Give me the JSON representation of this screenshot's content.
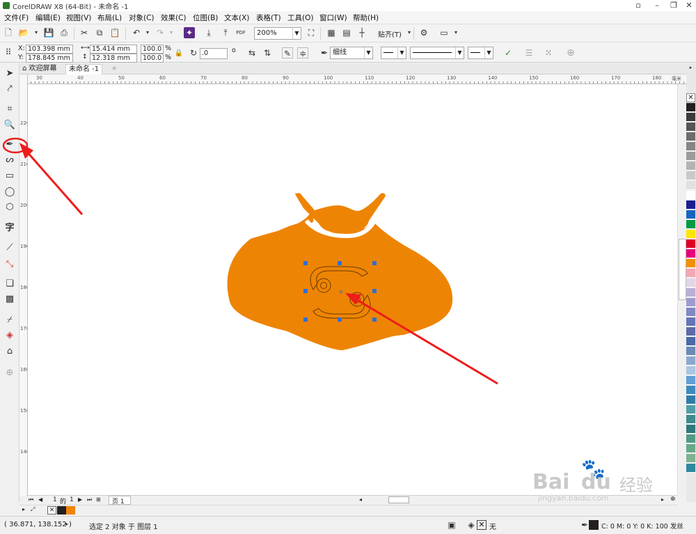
{
  "titlebar": {
    "title": "CorelDRAW X8 (64-Bit) - 未命名 -1",
    "restore": "▫",
    "minimize": "–",
    "maximize": "❐",
    "close": "✕"
  },
  "menu": [
    "文件(F)",
    "编辑(E)",
    "视图(V)",
    "布局(L)",
    "对象(C)",
    "效果(C)",
    "位图(B)",
    "文本(X)",
    "表格(T)",
    "工具(O)",
    "窗口(W)",
    "帮助(H)"
  ],
  "stdbar": {
    "zoom": "200%",
    "snap_label": "贴齐(T)",
    "pdf_label": "PDF"
  },
  "propbar": {
    "x_label": "X:",
    "x": "103.398 mm",
    "y_label": "Y:",
    "y": "178.845 mm",
    "w": "15.414 mm",
    "h": "12.318 mm",
    "sx": "100.0",
    "sy": "100.0",
    "pct": "%",
    "rotation": ".0",
    "deg": "o",
    "outline_width": "细线"
  },
  "tabs": {
    "welcome": "欢迎屏幕",
    "doc": "未命名 -1",
    "add": "+"
  },
  "ruler": {
    "h_ticks": [
      "30",
      "40",
      "50",
      "60",
      "70",
      "80",
      "90",
      "100",
      "110",
      "120",
      "130",
      "140",
      "150",
      "160",
      "170",
      "180"
    ],
    "h_unit": "毫米",
    "v_ticks": [
      "220",
      "210",
      "200",
      "190",
      "180",
      "170",
      "160",
      "150",
      "140"
    ]
  },
  "pagenav": {
    "current": "1",
    "of": "的",
    "total": "1",
    "page_tab": "页 1"
  },
  "status": {
    "coords": "( 36.871, 138.152 )",
    "selection": "选定 2 对象 于 图层 1",
    "fill_none": "无",
    "outline_info": "C: 0 M: 0 Y: 0 K: 100 发丝"
  },
  "colors": {
    "orange": "#ee8403",
    "handle": "#2f6fd1",
    "arrow": "#ee1c1c"
  },
  "palette": [
    "#231f20",
    "#3b3b3b",
    "#555555",
    "#6d6d6d",
    "#858585",
    "#9c9c9c",
    "#b3b3b3",
    "#cacaca",
    "#e0e0e0",
    "#ffffff",
    "#1b1f8f",
    "#1565c0",
    "#009a44",
    "#ffe600",
    "#e00024",
    "#e6007e",
    "#f29100",
    "#f2a7b4",
    "#e3d5e8",
    "#b8b0d6",
    "#9d9cd0",
    "#7f88c4",
    "#6474b6",
    "#5e6aa6",
    "#4a6aa8",
    "#6a8ab8",
    "#8aa9cf",
    "#aac6e2",
    "#5fa0d6",
    "#3b8bbf",
    "#2e7da8",
    "#4f9ea8",
    "#3b8c8c",
    "#2e7a7a",
    "#4f9a86",
    "#67a78a",
    "#7fb38f",
    "#2e8a9e"
  ],
  "watermark": {
    "brand": "Bai",
    "brand2": "du",
    "jy": "经验",
    "url": "jingyan.baidu.com"
  }
}
